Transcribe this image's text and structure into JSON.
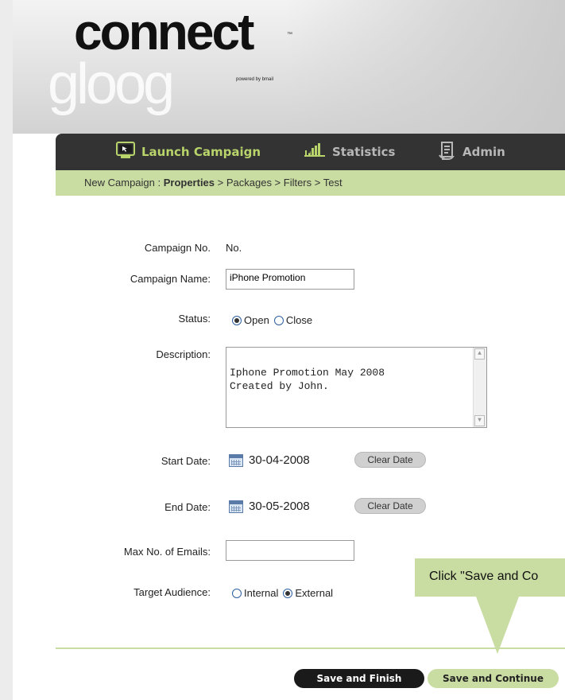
{
  "logo": {
    "main": "connect",
    "tm": "™",
    "powered": "powered by bmail",
    "sub": "gloog"
  },
  "nav": {
    "items": [
      {
        "label": "Launch Campaign",
        "icon": "monitor-icon",
        "color": "#b8d46a"
      },
      {
        "label": "Statistics",
        "icon": "bar-chart-icon",
        "color": "#b7b7b7"
      },
      {
        "label": "Admin",
        "icon": "document-icon",
        "color": "#b7b7b7"
      }
    ]
  },
  "breadcrumb": {
    "prefix": "New Campaign : ",
    "current": "Properties",
    "rest": " > Packages > Filters > Test"
  },
  "form": {
    "campaign_no": {
      "label": "Campaign No.",
      "value": "No."
    },
    "campaign_name": {
      "label": "Campaign Name:",
      "value": "iPhone Promotion"
    },
    "status": {
      "label": "Status:",
      "options": [
        "Open",
        "Close"
      ],
      "selected": "Open"
    },
    "description": {
      "label": "Description:",
      "value": "Iphone Promotion May 2008\nCreated by John."
    },
    "start_date": {
      "label": "Start Date:",
      "value": "30-04-2008",
      "clear_label": "Clear Date"
    },
    "end_date": {
      "label": "End Date:",
      "value": "30-05-2008",
      "clear_label": "Clear Date"
    },
    "max_emails": {
      "label": "Max No. of Emails:",
      "value": ""
    },
    "target_audience": {
      "label": "Target Audience:",
      "options": [
        "Internal",
        "External"
      ],
      "selected": "External"
    }
  },
  "buttons": {
    "save_finish": "Save and Finish",
    "save_continue": "Save and Continue"
  },
  "tooltip": {
    "text": "Click \"Save and Co"
  },
  "colors": {
    "accent_green": "#c9dca2",
    "nav_bg": "#333333"
  }
}
